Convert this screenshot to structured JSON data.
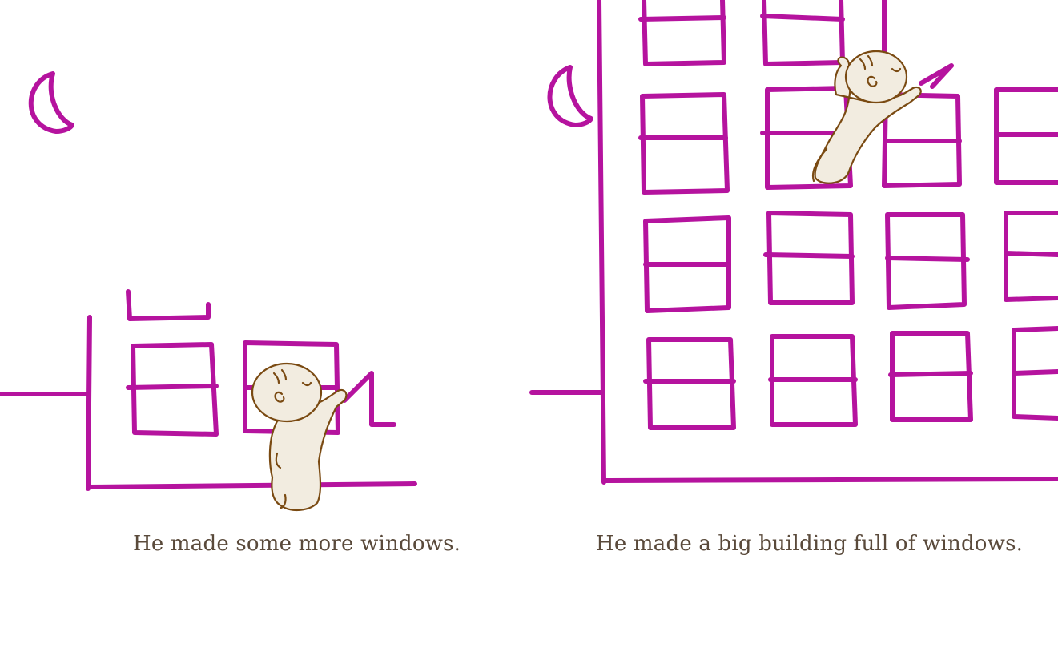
{
  "pages": [
    {
      "caption": "He made some more windows."
    },
    {
      "caption": "He made a big building full of windows."
    }
  ],
  "colors": {
    "crayon": "#b5139e",
    "outline": "#7a4a12",
    "skin": "#f2ece0",
    "text": "#5a4a3b",
    "background": "#ffffff"
  },
  "icons": {
    "moon": "crescent-moon-icon",
    "character": "baby-character"
  }
}
